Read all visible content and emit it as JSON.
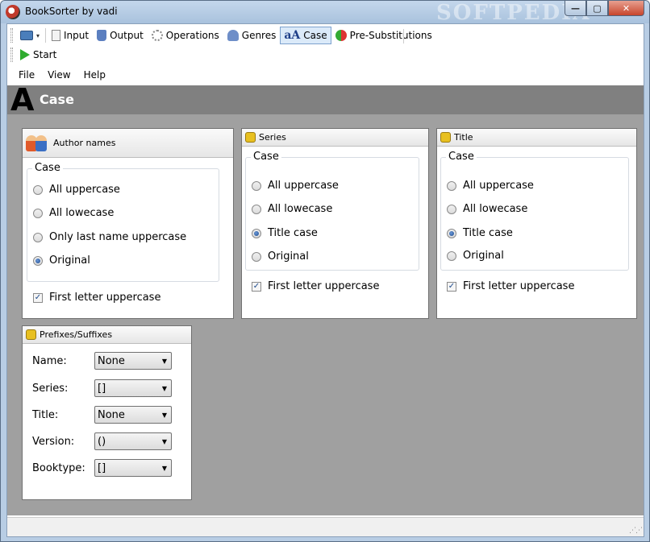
{
  "window": {
    "title": "BookSorter by vadi",
    "watermark": "SOFTPEDIA"
  },
  "toolbar": {
    "items": [
      {
        "label": "Input",
        "icon": "document-icon"
      },
      {
        "label": "Output",
        "icon": "disk-icon"
      },
      {
        "label": "Operations",
        "icon": "gears-icon"
      },
      {
        "label": "Genres",
        "icon": "genres-icon"
      },
      {
        "label": "Case",
        "icon": "case-icon",
        "active": true
      },
      {
        "label": "Pre-Substitutions",
        "icon": "pre-substitutions-icon"
      }
    ],
    "start_label": "Start"
  },
  "menu": {
    "items": [
      "File",
      "View",
      "Help"
    ]
  },
  "header": {
    "title": "Case",
    "glyph": "A"
  },
  "panels": {
    "author": {
      "title": "Author names",
      "group_label": "Case",
      "options": [
        "All uppercase",
        "All lowecase",
        "Only last name uppercase",
        "Original"
      ],
      "selected": "Original",
      "checkbox_label": "First letter uppercase",
      "checkbox_checked": true
    },
    "series": {
      "title": "Series",
      "group_label": "Case",
      "options": [
        "All uppercase",
        "All lowecase",
        "Title case",
        "Original"
      ],
      "selected": "Title case",
      "checkbox_label": "First letter uppercase",
      "checkbox_checked": true
    },
    "title": {
      "title": "Title",
      "group_label": "Case",
      "options": [
        "All uppercase",
        "All lowecase",
        "Title case",
        "Original"
      ],
      "selected": "Title case",
      "checkbox_label": "First letter uppercase",
      "checkbox_checked": true
    },
    "prefixes": {
      "title": "Prefixes/Suffixes",
      "fields": [
        {
          "label": "Name:",
          "value": "None"
        },
        {
          "label": "Series:",
          "value": "[]"
        },
        {
          "label": "Title:",
          "value": "None"
        },
        {
          "label": "Version:",
          "value": "()"
        },
        {
          "label": "Booktype:",
          "value": "[]"
        }
      ]
    }
  },
  "glyphs": {
    "check": "✓",
    "dropdown_arrow": "▼",
    "caret": "▾"
  }
}
